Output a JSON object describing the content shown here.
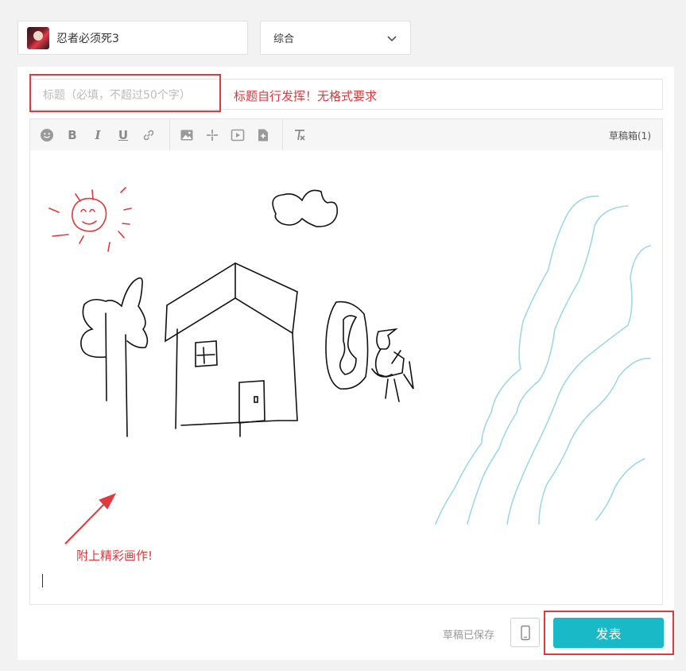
{
  "header": {
    "game_name": "忍者必须死3",
    "category": "综合"
  },
  "title": {
    "placeholder": "标题（必填，不超过50个字）",
    "value": "",
    "annotation": "标题自行发挥！无格式要求"
  },
  "toolbar": {
    "icons": [
      "emoji-icon",
      "bold-icon",
      "italic-icon",
      "underline-icon",
      "link-icon",
      "image-icon",
      "sparkle-icon",
      "video-icon",
      "file-icon",
      "clear-format-icon"
    ],
    "bold_label": "B",
    "italic_label": "I",
    "underline_label": "U",
    "drafts_label": "草稿箱(1)"
  },
  "editor": {
    "annotation": "附上精彩画作!",
    "colors": {
      "sun": "#e0393e",
      "ink": "#111111",
      "river": "#9fd8e4",
      "arrow": "#e0393e"
    }
  },
  "footer": {
    "saved_status": "草稿已保存",
    "publish_label": "发表",
    "publish_color": "#19b9c8",
    "highlight_color": "#e0393e"
  }
}
